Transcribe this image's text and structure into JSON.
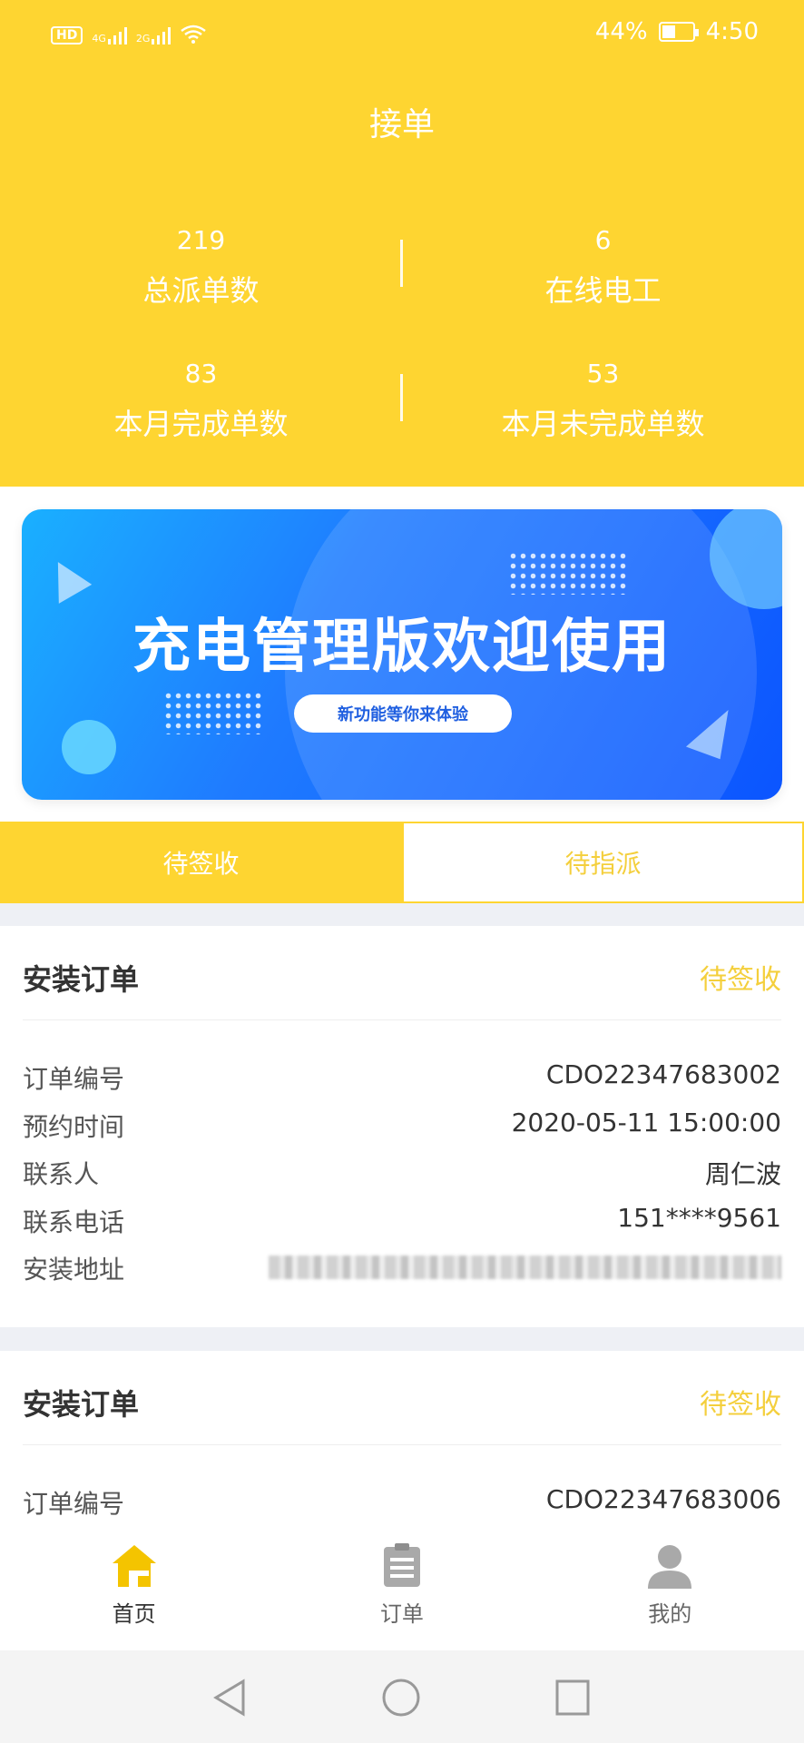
{
  "status_bar": {
    "network_hd": "HD",
    "sig1_label": "4G",
    "sig2_label": "2G",
    "battery": "44%",
    "battery_level": 0.44,
    "time": "4:50"
  },
  "header": {
    "title": "接单",
    "stats": [
      {
        "value": "219",
        "label": "总派单数"
      },
      {
        "value": "6",
        "label": "在线电工"
      },
      {
        "value": "83",
        "label": "本月完成单数"
      },
      {
        "value": "53",
        "label": "本月未完成单数"
      }
    ]
  },
  "banner": {
    "headline": "充电管理版欢迎使用",
    "pill": "新功能等你来体验"
  },
  "tabs": [
    {
      "label": "待签收",
      "active": true
    },
    {
      "label": "待指派",
      "active": false
    }
  ],
  "orders": [
    {
      "title": "安装订单",
      "status": "待签收",
      "fields": [
        {
          "key": "订单编号",
          "value": "CDO22347683002"
        },
        {
          "key": "预约时间",
          "value": "2020-05-11 15:00:00"
        },
        {
          "key": "联系人",
          "value": "周仁波"
        },
        {
          "key": "联系电话",
          "value": "151****9561"
        },
        {
          "key": "安装地址",
          "value": ""
        }
      ]
    },
    {
      "title": "安装订单",
      "status": "待签收",
      "fields": [
        {
          "key": "订单编号",
          "value": "CDO22347683006"
        }
      ]
    }
  ],
  "bottom_nav": [
    {
      "label": "首页",
      "icon": "home-icon",
      "active": true
    },
    {
      "label": "订单",
      "icon": "clipboard-icon",
      "active": false
    },
    {
      "label": "我的",
      "icon": "user-icon",
      "active": false
    }
  ],
  "colors": {
    "brand_yellow": "#fed531",
    "status_yellow": "#f4cf3c",
    "banner_blue": "#1f7bff"
  }
}
